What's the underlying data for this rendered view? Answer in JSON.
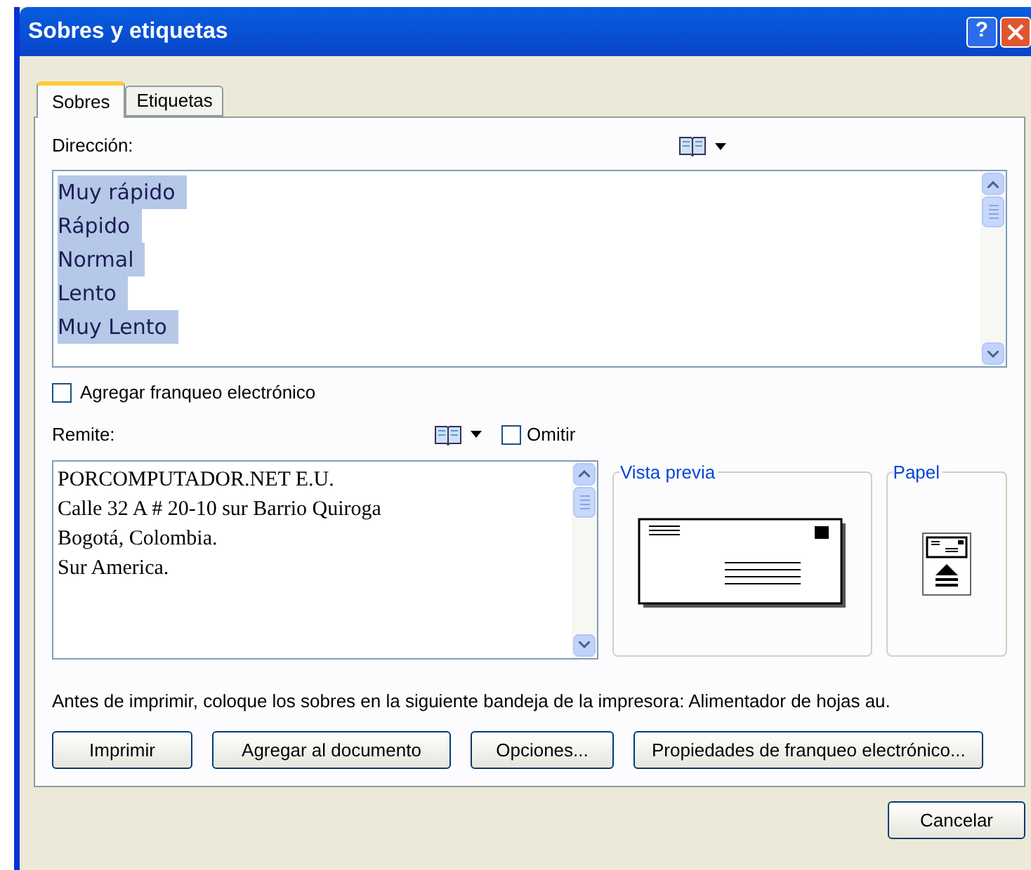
{
  "window": {
    "title": "Sobres y etiquetas",
    "help_button": "?"
  },
  "tabs": [
    {
      "label": "Sobres",
      "selected": true
    },
    {
      "label": "Etiquetas",
      "selected": false
    }
  ],
  "address": {
    "label": "Dirección:",
    "lines": [
      {
        "text": "Muy rápido",
        "selected": true
      },
      {
        "text": "Rápido",
        "selected": true
      },
      {
        "text": "Normal",
        "selected": true
      },
      {
        "text": "Lento",
        "selected": true
      },
      {
        "text": "Muy Lento",
        "selected": true
      }
    ]
  },
  "electronic_postage": {
    "label": "Agregar franqueo electrónico",
    "checked": false
  },
  "return_address": {
    "label": "Remite:",
    "omit": {
      "label": "Omitir",
      "checked": false
    },
    "lines": [
      "PORCOMPUTADOR.NET E.U.",
      "Calle 32 A # 20-10 sur Barrio Quiroga",
      "Bogotá, Colombia.",
      "Sur America."
    ]
  },
  "preview": {
    "title": "Vista previa"
  },
  "paper": {
    "title": "Papel"
  },
  "note": "Antes de imprimir, coloque los sobres en la siguiente bandeja de la impresora: Alimentador de hojas au.",
  "buttons": [
    "Imprimir",
    "Agregar al documento",
    "Opciones...",
    "Propiedades de franqueo electrónico..."
  ],
  "footer_buttons": [
    "Cancelar"
  ]
}
